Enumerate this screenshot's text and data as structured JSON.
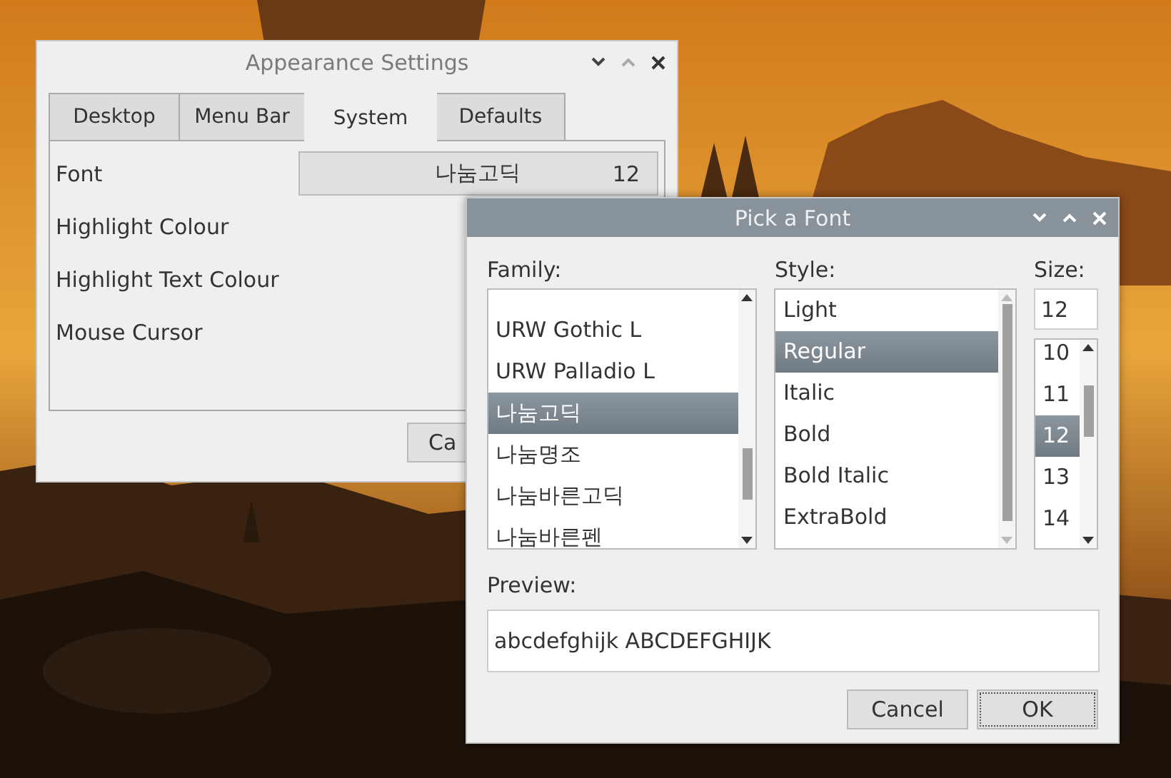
{
  "appearance_window": {
    "title": "Appearance Settings",
    "tabs": [
      {
        "label": "Desktop",
        "selected": false
      },
      {
        "label": "Menu Bar",
        "selected": false
      },
      {
        "label": "System",
        "selected": true
      },
      {
        "label": "Defaults",
        "selected": false
      }
    ],
    "rows": [
      "Font",
      "Highlight Colour",
      "Highlight Text Colour",
      "Mouse Cursor"
    ],
    "font_button": {
      "family": "나눔고딕",
      "size": "12"
    },
    "cancel_button": "Ca"
  },
  "font_dialog": {
    "title": "Pick a Font",
    "family_label": "Family:",
    "families": [
      {
        "name": "URW Gothic L",
        "selected": false
      },
      {
        "name": "URW Palladio L",
        "selected": false
      },
      {
        "name": "나눔고딕",
        "selected": true
      },
      {
        "name": "나눔명조",
        "selected": false
      },
      {
        "name": "나눔바른고딕",
        "selected": false
      },
      {
        "name": "나눔바른펜",
        "selected": false
      }
    ],
    "style_label": "Style:",
    "styles": [
      {
        "name": "Light",
        "selected": false
      },
      {
        "name": "Regular",
        "selected": true
      },
      {
        "name": "Italic",
        "selected": false
      },
      {
        "name": "Bold",
        "selected": false
      },
      {
        "name": "Bold Italic",
        "selected": false
      },
      {
        "name": "ExtraBold",
        "selected": false
      }
    ],
    "size_label": "Size:",
    "size_value": "12",
    "sizes": [
      {
        "name": "10",
        "selected": false
      },
      {
        "name": "11",
        "selected": false
      },
      {
        "name": "12",
        "selected": true
      },
      {
        "name": "13",
        "selected": false
      },
      {
        "name": "14",
        "selected": false
      }
    ],
    "preview_label": "Preview:",
    "preview_text": "abcdefghijk ABCDEFGHIJK",
    "buttons": [
      {
        "label": "Cancel",
        "focused": false
      },
      {
        "label": "OK",
        "focused": true
      }
    ]
  }
}
